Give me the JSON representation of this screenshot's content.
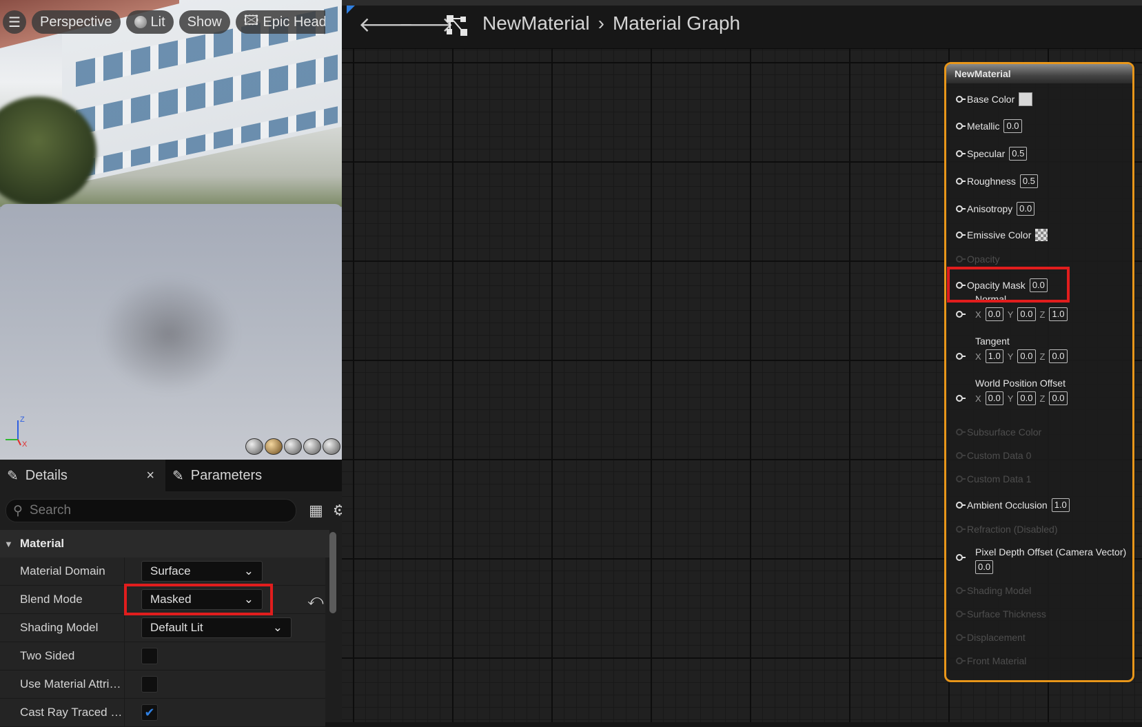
{
  "viewport": {
    "toolbar": {
      "menu_icon": "hamburger-icon",
      "perspective_label": "Perspective",
      "lit_label": "Lit",
      "show_label": "Show",
      "preview_label": "Epic Headq"
    },
    "axis": {
      "z": "Z",
      "x": "X"
    }
  },
  "details": {
    "tab_details": "Details",
    "tab_close": "×",
    "tab_parameters": "Parameters",
    "search_placeholder": "Search",
    "section": "Material",
    "properties": [
      {
        "name": "Material Domain",
        "value": "Surface"
      },
      {
        "name": "Blend Mode",
        "value": "Masked"
      },
      {
        "name": "Shading Model",
        "value": "Default Lit"
      },
      {
        "name": "Two Sided",
        "checked": false
      },
      {
        "name": "Use Material Attribu...",
        "checked": false
      },
      {
        "name": "Cast Ray Traced Sh...",
        "checked": true
      }
    ]
  },
  "graph": {
    "breadcrumb_root": "NewMaterial",
    "breadcrumb_sep": "›",
    "breadcrumb_current": "Material Graph"
  },
  "node": {
    "title": "NewMaterial",
    "pins": {
      "base_color": "Base Color",
      "metallic": "Metallic",
      "metallic_val": "0.0",
      "specular": "Specular",
      "specular_val": "0.5",
      "roughness": "Roughness",
      "roughness_val": "0.5",
      "anisotropy": "Anisotropy",
      "anisotropy_val": "0.0",
      "emissive": "Emissive Color",
      "opacity": "Opacity",
      "opacity_mask": "Opacity Mask",
      "opacity_mask_val": "0.0",
      "normal": "Normal",
      "normal_x": "0.0",
      "normal_y": "0.0",
      "normal_z": "1.0",
      "tangent": "Tangent",
      "tangent_x": "1.0",
      "tangent_y": "0.0",
      "tangent_z": "0.0",
      "wpo": "World Position Offset",
      "wpo_x": "0.0",
      "wpo_y": "0.0",
      "wpo_z": "0.0",
      "subsurface": "Subsurface Color",
      "custom0": "Custom Data 0",
      "custom1": "Custom Data 1",
      "ao": "Ambient Occlusion",
      "ao_val": "1.0",
      "refraction": "Refraction (Disabled)",
      "pdo": "Pixel Depth Offset (Camera Vector)",
      "pdo_val": "0.0",
      "shading_model": "Shading Model",
      "surface_thickness": "Surface Thickness",
      "displacement": "Displacement",
      "front_material": "Front Material",
      "axis_x": "X",
      "axis_y": "Y",
      "axis_z": "Z"
    }
  },
  "colors": {
    "highlight": "#e11d1d",
    "node_border": "#e8961a",
    "accent": "#2f7fe0"
  }
}
